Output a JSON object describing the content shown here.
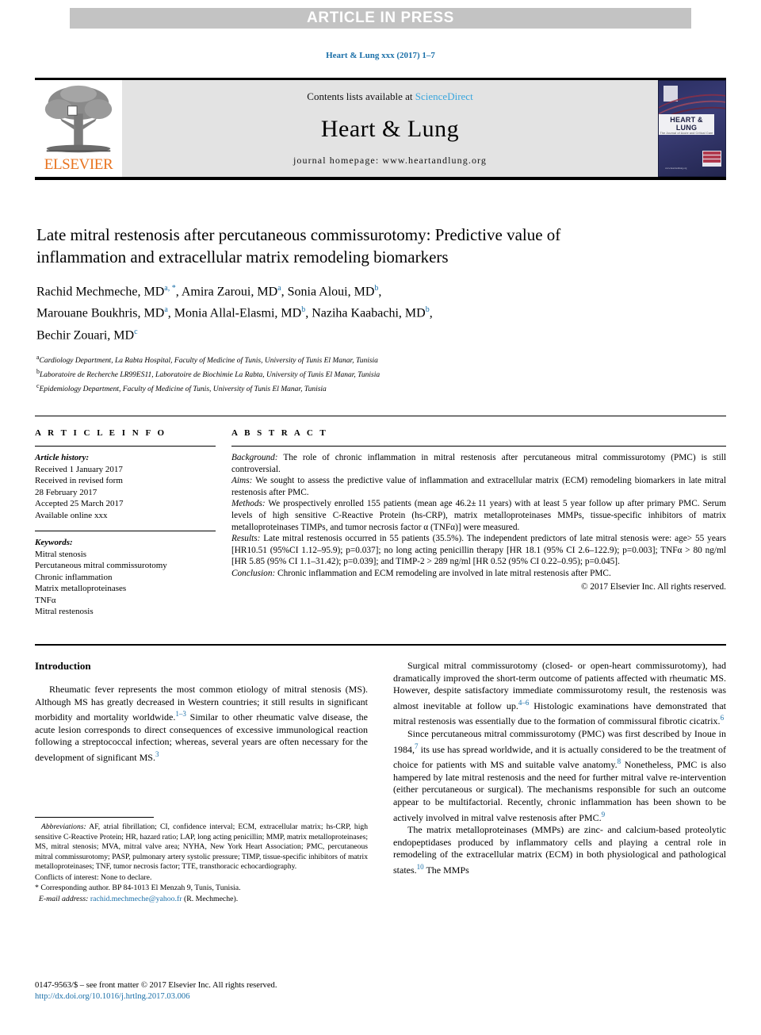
{
  "banner": {
    "text": "ARTICLE IN PRESS"
  },
  "running_head": {
    "text": "Heart & Lung xxx (2017) 1–7"
  },
  "masthead": {
    "contents_prefix": "Contents lists available at ",
    "sciencedirect": "ScienceDirect",
    "journal_name": "Heart & Lung",
    "homepage": "journal homepage: www.heartandlung.org",
    "publisher": "ELSEVIER",
    "cover_title": "HEART & LUNG",
    "cover_subtitle": "The Journal of Acute and Critical Care",
    "cover_url": "www.heartandlung.org"
  },
  "article": {
    "title": "Late mitral restenosis after percutaneous commissurotomy: Predictive value of inflammation and extracellular matrix remodeling biomarkers",
    "authors_html": "Rachid Mechmeche, MD<sup>a, *</sup>, Amira Zaroui, MD<sup>a</sup>, Sonia Aloui, MD<sup>b</sup>,<br>Marouane Boukhris, MD<sup>a</sup>, Monia Allal-Elasmi, MD<sup>b</sup>, Naziha Kaabachi, MD<sup>b</sup>,<br>Bechir Zouari, MD<sup>c</sup>",
    "affiliations": [
      {
        "marker": "a",
        "text": "Cardiology Department, La Rabta Hospital, Faculty of Medicine of Tunis, University of Tunis El Manar, Tunisia"
      },
      {
        "marker": "b",
        "text": "Laboratoire de Recherche LR99ES11, Laboratoire de Biochimie La Rabta, University of Tunis El Manar, Tunisia"
      },
      {
        "marker": "c",
        "text": "Epidemiology Department, Faculty of Medicine of Tunis, University of Tunis El Manar, Tunisia"
      }
    ]
  },
  "article_info": {
    "heading": "A R T I C L E   I N F O",
    "history_label": "Article history:",
    "history": [
      "Received 1 January 2017",
      "Received in revised form",
      "28 February 2017",
      "Accepted 25 March 2017",
      "Available online xxx"
    ],
    "keywords_label": "Keywords:",
    "keywords": [
      "Mitral stenosis",
      "Percutaneous mitral commissurotomy",
      "Chronic inflammation",
      "Matrix metalloproteinases",
      "TNFα",
      "Mitral restenosis"
    ]
  },
  "abstract": {
    "heading": "A B S T R A C T",
    "sections": [
      {
        "label": "Background:",
        "text": " The role of chronic inflammation in mitral restenosis after percutaneous mitral commissurotomy (PMC) is still controversial."
      },
      {
        "label": "Aims:",
        "text": " We sought to assess the predictive value of inflammation and extracellular matrix (ECM) remodeling biomarkers in late mitral restenosis after PMC."
      },
      {
        "label": "Methods:",
        "text": " We prospectively enrolled 155 patients (mean age 46.2± 11 years) with at least 5 year follow up after primary PMC. Serum levels of high sensitive C-Reactive Protein (hs-CRP), matrix metalloproteinases MMPs, tissue-specific inhibitors of matrix metalloproteinases TIMPs, and tumor necrosis factor α (TNFα)] were measured."
      },
      {
        "label": "Results:",
        "text": " Late mitral restenosis occurred in 55 patients (35.5%). The independent predictors of late mitral stenosis were: age> 55 years [HR10.51 (95%CI 1.12–95.9); p=0.037]; no long acting penicillin therapy [HR 18.1 (95% CI 2.6–122.9); p=0.003]; TNFα > 80 ng/ml [HR 5.85 (95% CI 1.1–31.42); p=0.039]; and TIMP-2 > 289 ng/ml [HR 0.52 (95% CI 0.22–0.95); p=0.045]."
      },
      {
        "label": "Conclusion:",
        "text": " Chronic inflammation and ECM remodeling are involved in late mitral restenosis after PMC."
      }
    ],
    "copyright": "© 2017 Elsevier Inc. All rights reserved."
  },
  "body": {
    "intro_heading": "Introduction",
    "left_paragraphs": [
      "Rheumatic fever represents the most common etiology of mitral stenosis (MS). Although MS has greatly decreased in Western countries; it still results in significant morbidity and mortality worldwide.<sup>1–3</sup> Similar to other rheumatic valve disease, the acute lesion corresponds to direct consequences of excessive immunological reaction following a streptococcal infection; whereas, several years are often necessary for the development of significant MS.<sup>3</sup>"
    ],
    "right_paragraphs": [
      "Surgical mitral commissurotomy (closed- or open-heart commissurotomy), had dramatically improved the short-term outcome of patients affected with rheumatic MS. However, despite satisfactory immediate commissurotomy result, the restenosis was almost inevitable at follow up.<sup>4–6</sup> Histologic examinations have demonstrated that mitral restenosis was essentially due to the formation of commissural fibrotic cicatrix.<sup>6</sup>",
      "Since percutaneous mitral commissurotomy (PMC) was first described by Inoue in 1984,<sup>7</sup> its use has spread worldwide, and it is actually considered to be the treatment of choice for patients with MS and suitable valve anatomy.<sup>8</sup> Nonetheless, PMC is also hampered by late mitral restenosis and the need for further mitral valve re-intervention (either percutaneous or surgical). The mechanisms responsible for such an outcome appear to be multifactorial. Recently, chronic inflammation has been shown to be actively involved in mitral valve restenosis after PMC.<sup>9</sup>",
      "The matrix metalloproteinases (MMPs) are zinc- and calcium-based proteolytic endopeptidases produced by inflammatory cells and playing a central role in remodeling of the extracellular matrix (ECM) in both physiological and pathological states.<sup>10</sup> The MMPs"
    ]
  },
  "footnotes": {
    "abbreviations_label": "Abbreviations:",
    "abbreviations_text": " AF, atrial fibrillation; CI, confidence interval; ECM, extracellular matrix; hs-CRP, high sensitive C-Reactive Protein; HR, hazard ratio; LAP, long acting penicillin; MMP, matrix metalloproteinases; MS, mitral stenosis; MVA, mitral valve area; NYHA, New York Heart Association; PMC, percutaneous mitral commissurotomy; PASP, pulmonary artery systolic pressure; TIMP, tissue-specific inhibitors of matrix metalloproteinases; TNF, tumor necrosis factor; TTE, transthoracic echocardiography.",
    "conflicts": "Conflicts of interest: None to declare.",
    "corresponding": "* Corresponding author. BP 84-1013 El Menzah 9, Tunis, Tunisia.",
    "email_label": "E-mail address:",
    "email": "rachid.mechmeche@yahoo.fr",
    "email_suffix": " (R. Mechmeche)."
  },
  "colophon": {
    "line1": "0147-9563/$ – see front matter © 2017 Elsevier Inc. All rights reserved.",
    "doi": "http://dx.doi.org/10.1016/j.hrtlng.2017.03.006"
  },
  "colors": {
    "link": "#1a6fa8",
    "banner_bg": "#c3c3c3",
    "masthead_bg": "#e3e3e3",
    "elsevier_orange": "#e8731f"
  }
}
